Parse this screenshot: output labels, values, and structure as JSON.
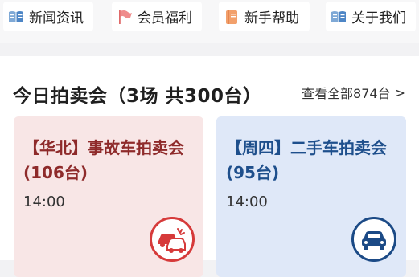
{
  "nav": {
    "items": [
      {
        "label": "新闻资讯",
        "icon": "book-icon"
      },
      {
        "label": "会员福利",
        "icon": "flag-icon"
      },
      {
        "label": "新手帮助",
        "icon": "guide-book-icon"
      },
      {
        "label": "关于我们",
        "icon": "book-icon"
      }
    ]
  },
  "section": {
    "title": "今日拍卖会（3场 共300台）",
    "view_all": "查看全部874台",
    "view_all_chevron": ">"
  },
  "cards": [
    {
      "title": "【华北】事故车拍卖会(106台)",
      "time": "14:00",
      "icon": "crashed-cars-icon",
      "color": "#d63a3a"
    },
    {
      "title": "【周四】二手车拍卖会(95台)",
      "time": "14:00",
      "icon": "car-front-icon",
      "color": "#1b4a86"
    }
  ]
}
